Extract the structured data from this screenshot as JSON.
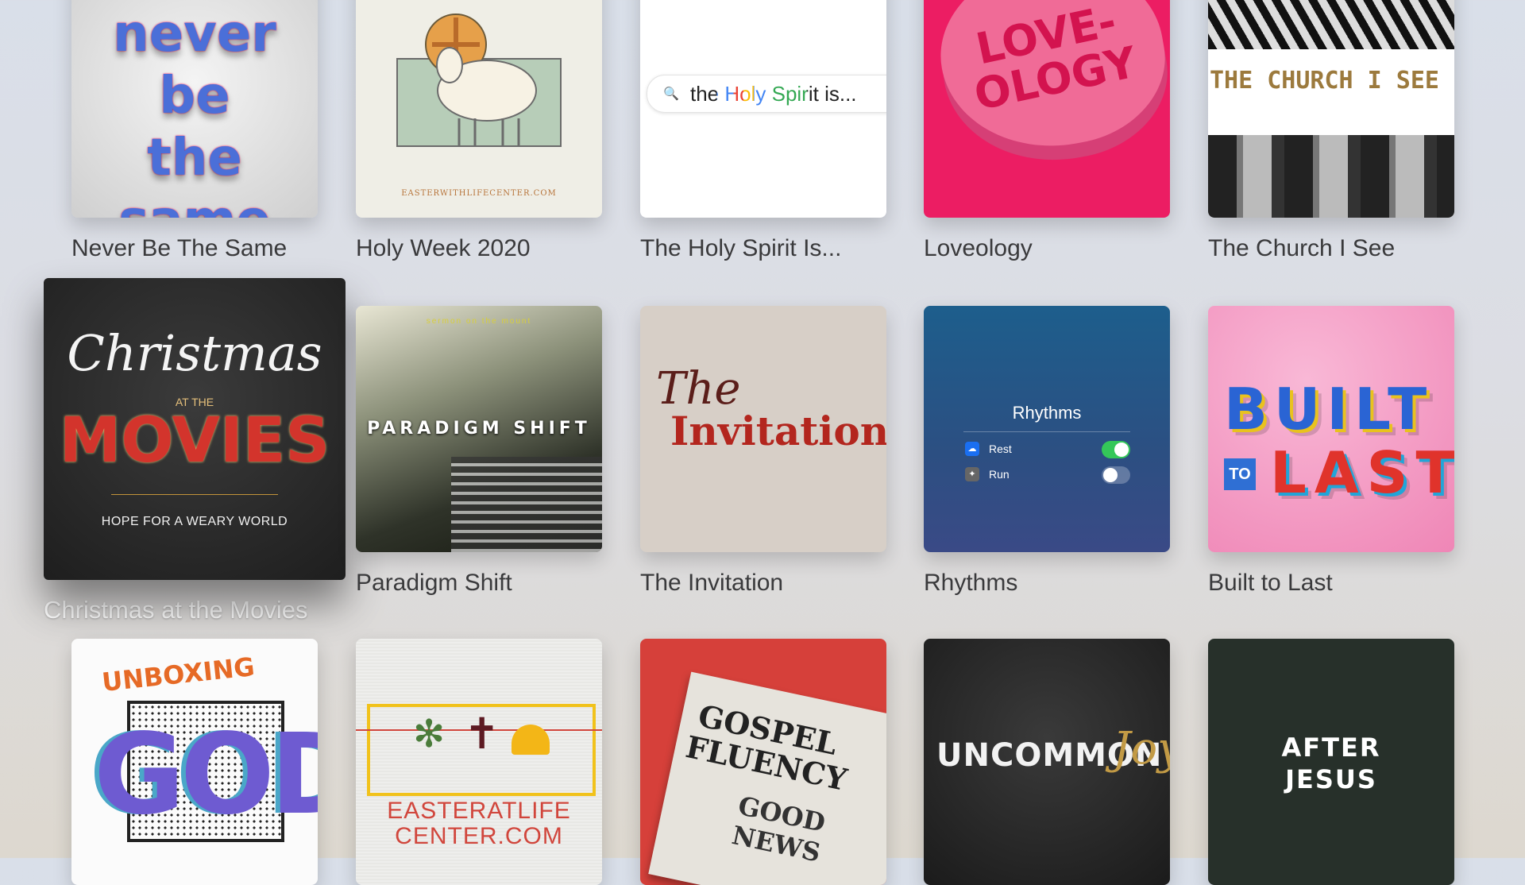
{
  "grid": {
    "row1": [
      {
        "title": "Never Be The Same",
        "art_text": "never be the same"
      },
      {
        "title": "Holy Week 2020",
        "art_text": "EASTERWITHLIFECENTER.COM"
      },
      {
        "title": "The Holy Spirit Is...",
        "art_text": "the Holy Spirit is..."
      },
      {
        "title": "Loveology",
        "art_text": "LOVE-OLOGY"
      },
      {
        "title": "The Church I See",
        "art_text": "THE CHURCH I SEE"
      }
    ],
    "row2": [
      {
        "title": "Christmas at the Movies",
        "art_script": "Christmas",
        "art_small": "AT THE",
        "art_big": "MOVIES",
        "art_sub": "HOPE FOR A WEARY WORLD"
      },
      {
        "title": "Paradigm Shift",
        "art_small": "sermon on the mount",
        "art_text": "PARADIGM SHIFT"
      },
      {
        "title": "The Invitation",
        "art_script": "The",
        "art_text": "Invitation"
      },
      {
        "title": "Rhythms",
        "art_heading": "Rhythms",
        "toggle_1": "Rest",
        "toggle_2": "Run"
      },
      {
        "title": "Built to Last",
        "art_big": "BUILT",
        "art_small": "TO",
        "art_big2": "LAST"
      }
    ],
    "row3": [
      {
        "art_small": "UNBOXING",
        "art_big": "GOD"
      },
      {
        "art_text": "EASTERATLIFE",
        "art_text2": "CENTER.COM"
      },
      {
        "art_text": "GOSPEL",
        "art_text2": "FLUENCY",
        "art_small": "GOOD NEWS"
      },
      {
        "art_text": "UNCOMMON",
        "art_script": "Joy"
      },
      {
        "art_text": "AFTER",
        "art_text2": "JESUS"
      }
    ]
  },
  "colors": {
    "focused_label": "#ffffff",
    "label": "#3a3a3c",
    "toggle_on": "#34c759"
  }
}
